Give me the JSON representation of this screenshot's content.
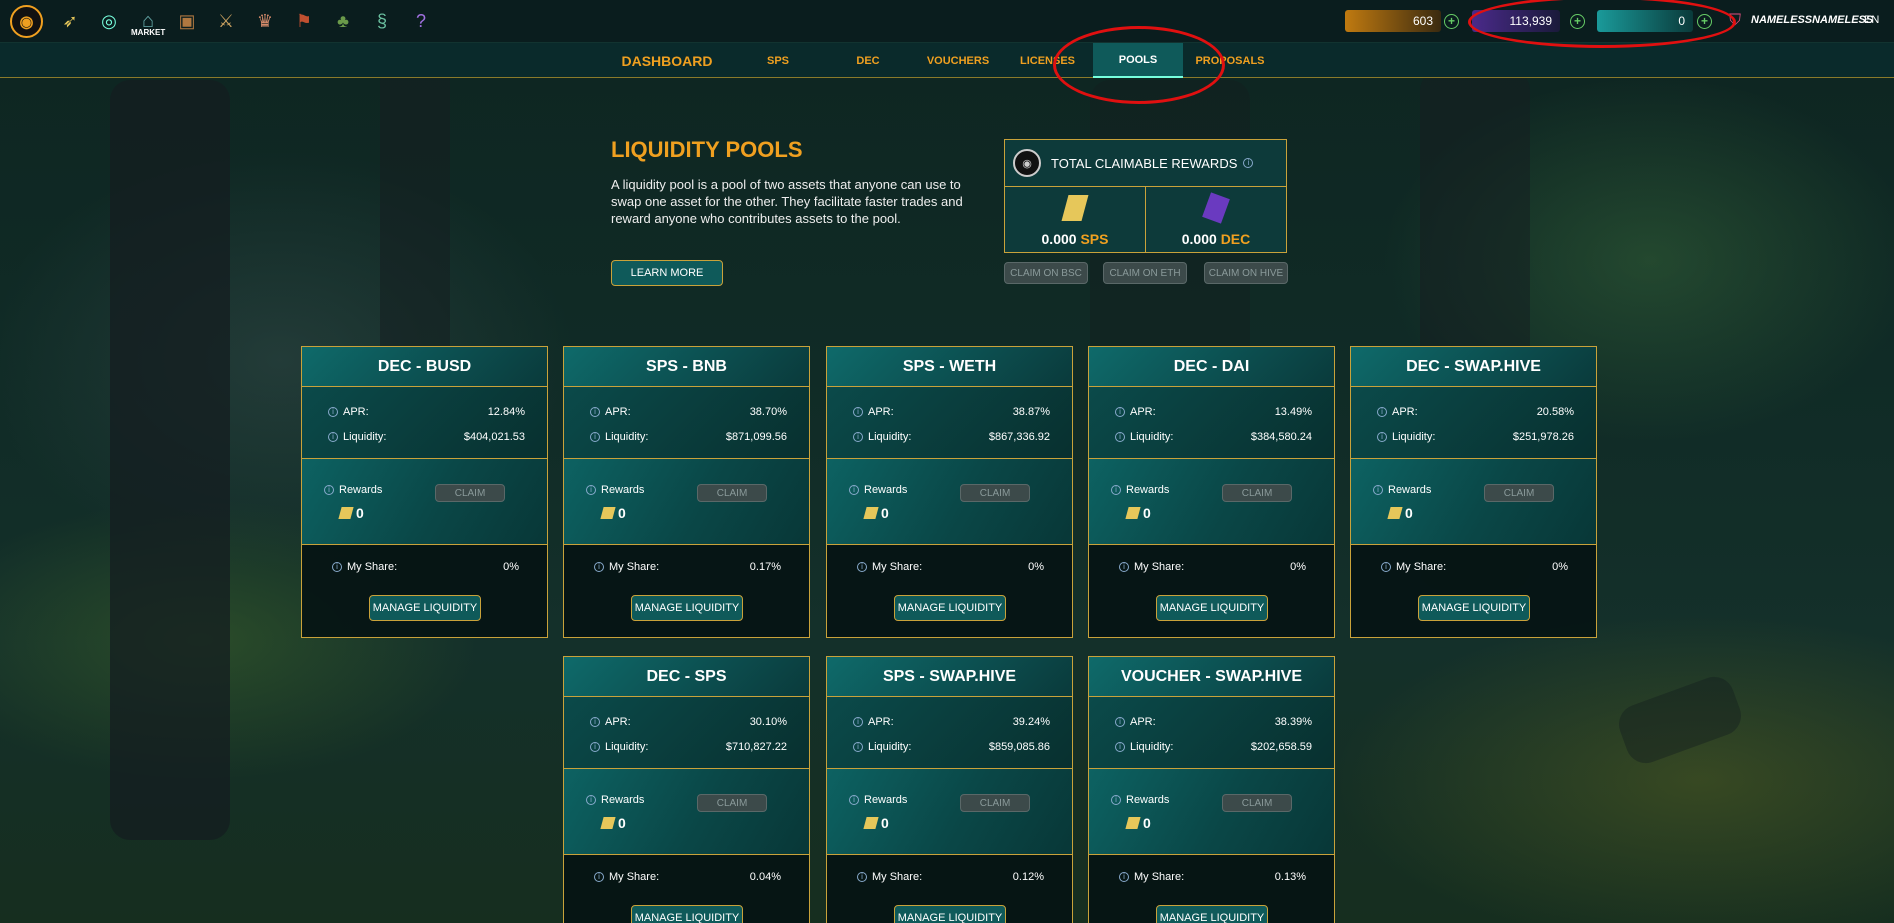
{
  "topbar": {
    "logo_glyph": "◉",
    "nav_icons": [
      "scroll-icon",
      "spiral-icon",
      "market-icon",
      "backpack-icon",
      "sword-icon",
      "cake-icon",
      "banner-icon",
      "land-icon",
      "serpent-icon",
      "question-icon"
    ],
    "market_label": "MARKET",
    "resources": {
      "credits": "603",
      "dec": "113,939",
      "sps": "0"
    },
    "username": "NAMELESSNAMELESS",
    "language": "EN"
  },
  "subnav": {
    "tabs": [
      "DASHBOARD",
      "SPS",
      "DEC",
      "VOUCHERS",
      "LICENSES",
      "POOLS",
      "PROPOSALS"
    ],
    "active": "POOLS"
  },
  "hero": {
    "title": "LIQUIDITY POOLS",
    "description": "A liquidity pool is a pool of two assets that anyone can use to swap one asset for the other. They facilitate faster trades and reward anyone who contributes assets to the pool.",
    "learn_more": "LEARN MORE"
  },
  "claimable": {
    "title": "TOTAL CLAIMABLE REWARDS",
    "sps_amount": "0.000",
    "sps_label": "SPS",
    "dec_amount": "0.000",
    "dec_label": "DEC",
    "buttons": [
      "CLAIM ON BSC",
      "CLAIM ON ETH",
      "CLAIM ON HIVE"
    ]
  },
  "labels": {
    "apr": "APR:",
    "liquidity": "Liquidity:",
    "rewards": "Rewards",
    "claim": "CLAIM",
    "my_share": "My Share:",
    "manage": "MANAGE LIQUIDITY"
  },
  "pools": [
    {
      "name": "DEC - BUSD",
      "apr": "12.84%",
      "liquidity": "$404,021.53",
      "rewards": "0",
      "share": "0%"
    },
    {
      "name": "SPS - BNB",
      "apr": "38.70%",
      "liquidity": "$871,099.56",
      "rewards": "0",
      "share": "0.17%"
    },
    {
      "name": "SPS - WETH",
      "apr": "38.87%",
      "liquidity": "$867,336.92",
      "rewards": "0",
      "share": "0%"
    },
    {
      "name": "DEC - DAI",
      "apr": "13.49%",
      "liquidity": "$384,580.24",
      "rewards": "0",
      "share": "0%"
    },
    {
      "name": "DEC - SWAP.HIVE",
      "apr": "20.58%",
      "liquidity": "$251,978.26",
      "rewards": "0",
      "share": "0%"
    },
    {
      "name": "DEC - SPS",
      "apr": "30.10%",
      "liquidity": "$710,827.22",
      "rewards": "0",
      "share": "0.04%"
    },
    {
      "name": "SPS - SWAP.HIVE",
      "apr": "39.24%",
      "liquidity": "$859,085.86",
      "rewards": "0",
      "share": "0.12%"
    },
    {
      "name": "VOUCHER - SWAP.HIVE",
      "apr": "38.39%",
      "liquidity": "$202,658.59",
      "rewards": "0",
      "share": "0.13%"
    }
  ]
}
